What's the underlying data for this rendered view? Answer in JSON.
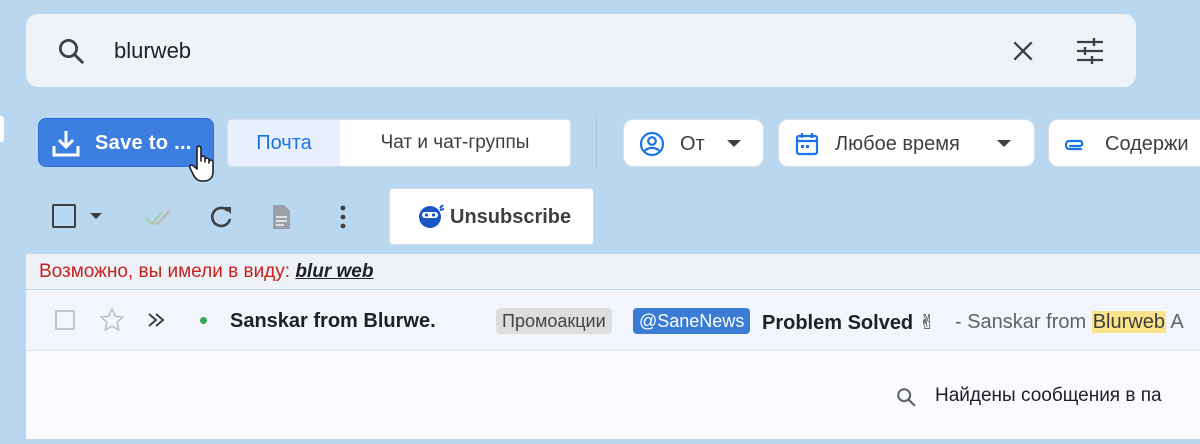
{
  "search": {
    "query": "blurweb",
    "icons": [
      "search-icon",
      "clear-icon",
      "search-options-icon"
    ]
  },
  "toolbar": {
    "save_label": "Save to ...",
    "segments": [
      "Почта",
      "Чат и чат-группы"
    ],
    "filters": {
      "from": "От",
      "time": "Любое время",
      "contains": "Содержи"
    }
  },
  "actions": {
    "unsubscribe": "Unsubscribe"
  },
  "suggestion": {
    "prefix": "Возможно, вы имели в виду:",
    "term": "blur web"
  },
  "messages": [
    {
      "sender": "Sanskar from Blurwe.",
      "labels": [
        "Промоакции",
        "@SaneNews"
      ],
      "subject": "Problem Solved ✌",
      "snippet_before": " - Sanskar from ",
      "snippet_highlight": "Blurweb",
      "snippet_after": " A"
    }
  ],
  "footer": {
    "found_text": "Найдены сообщения в па"
  },
  "colors": {
    "background": "#b9d7ef",
    "accent": "#1a73e8",
    "save_button": "#3c7fe0",
    "highlight": "#fbe38a",
    "unread_dot": "#34a853",
    "suggestion_text": "#c5221f"
  }
}
